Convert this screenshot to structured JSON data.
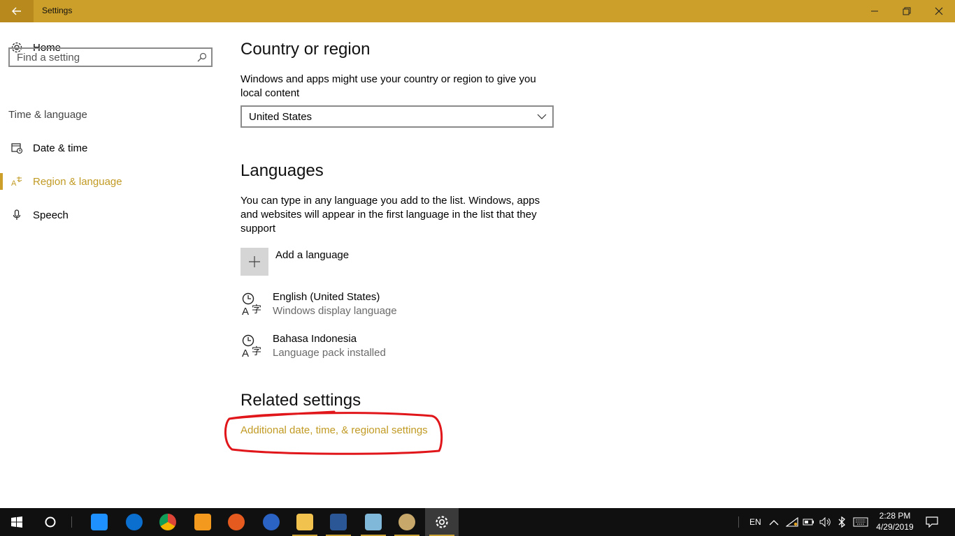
{
  "window": {
    "title": "Settings",
    "accent": "#cc9f2a"
  },
  "sidebar": {
    "home_label": "Home",
    "search_placeholder": "Find a setting",
    "section_title": "Time & language",
    "items": [
      {
        "label": "Date & time",
        "icon": "calendar-clock-icon"
      },
      {
        "label": "Region & language",
        "icon": "region-language-icon",
        "active": true
      },
      {
        "label": "Speech",
        "icon": "microphone-icon"
      }
    ]
  },
  "country": {
    "heading": "Country or region",
    "description": "Windows and apps might use your country or region to give you local content",
    "selected": "United States"
  },
  "languages": {
    "heading": "Languages",
    "description": "You can type in any language you add to the list. Windows, apps and websites will appear in the first language in the list that they support",
    "add_label": "Add a language",
    "list": [
      {
        "name": "English (United States)",
        "status": "Windows display language"
      },
      {
        "name": "Bahasa Indonesia",
        "status": "Language pack installed"
      }
    ]
  },
  "related": {
    "heading": "Related settings",
    "link": "Additional date, time, & regional settings"
  },
  "taskbar": {
    "apps": [
      "start-icon",
      "cortana-icon",
      "store-icon",
      "edge-icon",
      "chrome-icon",
      "uc-browser-icon",
      "firefox-icon",
      "google-earth-icon",
      "file-explorer-icon",
      "word-icon",
      "notes-icon",
      "paint-icon",
      "settings-icon"
    ],
    "lang": "EN",
    "time": "2:28 PM",
    "date": "4/29/2019"
  }
}
